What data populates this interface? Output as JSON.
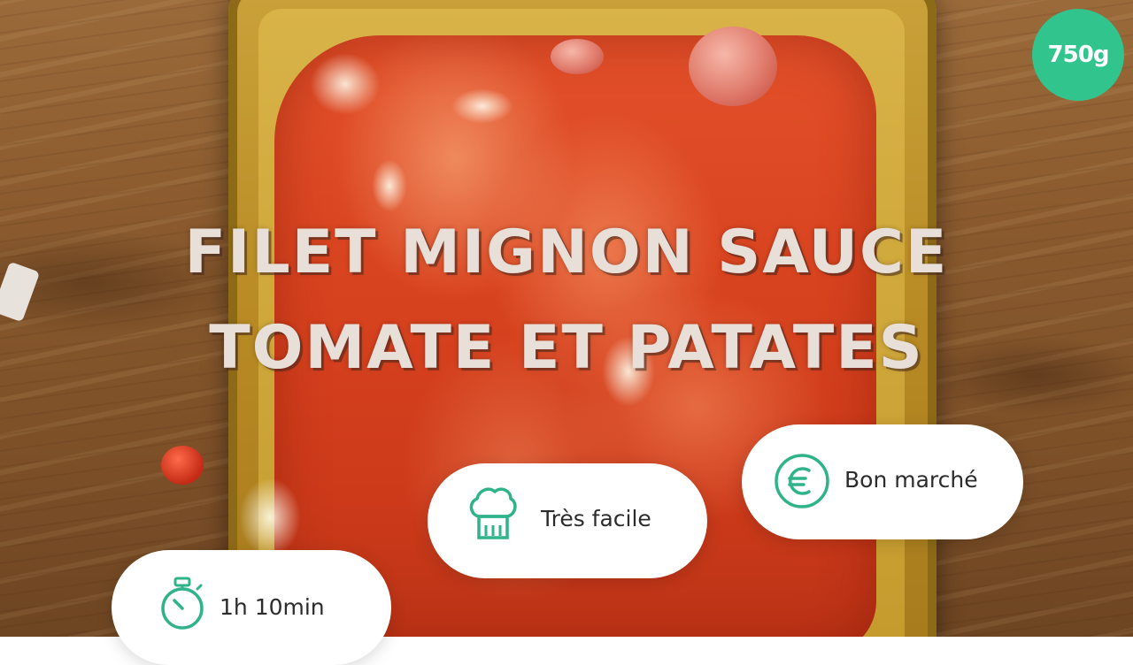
{
  "brand": {
    "logo_text": "750g",
    "accent": "#31c48d"
  },
  "recipe": {
    "title_line1": "FILET MIGNON SAUCE",
    "title_line2": "TOMATE ET PATATES"
  },
  "info": {
    "difficulty": {
      "label": "Très facile",
      "icon": "chef-hat-icon"
    },
    "cost": {
      "label": "Bon marché",
      "icon": "euro-icon"
    },
    "time": {
      "label": "1h 10min",
      "icon": "stopwatch-icon"
    }
  }
}
